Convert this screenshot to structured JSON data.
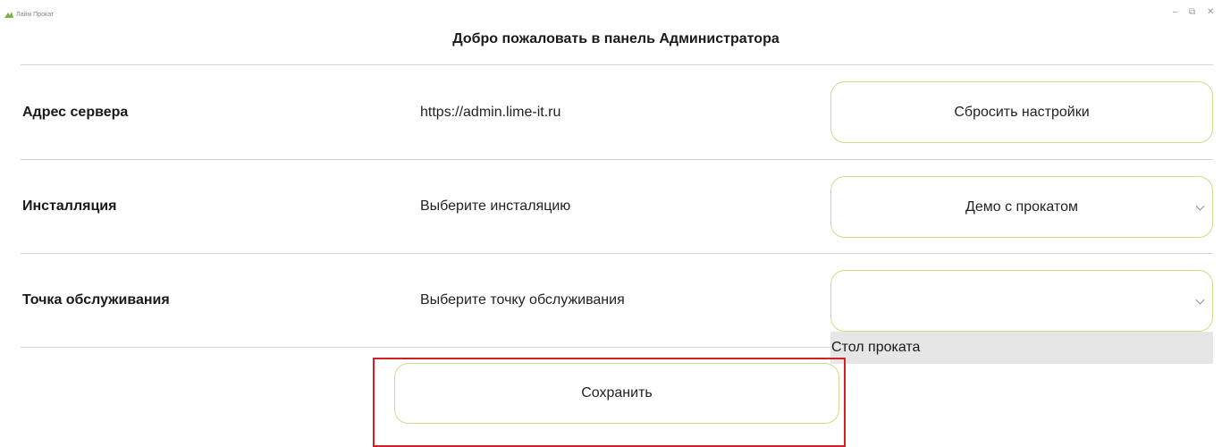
{
  "window": {
    "app_title": "Лайм Прокат",
    "minimize_glyph": "–",
    "restore_glyph": "⧉",
    "close_glyph": "✕"
  },
  "header": {
    "title": "Добро пожаловать в панель Администратора"
  },
  "rows": [
    {
      "label": "Адрес сервера",
      "value": "https://admin.lime-it.ru",
      "control": {
        "type": "button",
        "text": "Сбросить настройки"
      }
    },
    {
      "label": "Инсталляция",
      "value": "Выберите инсталяцию",
      "control": {
        "type": "select",
        "text": "Демо с прокатом"
      }
    },
    {
      "label": "Точка обслуживания",
      "value": "Выберите точку обслуживания",
      "control": {
        "type": "select",
        "text": ""
      }
    }
  ],
  "dropdown": {
    "options": [
      "Стол проката"
    ]
  },
  "save_button": {
    "label": "Сохранить"
  },
  "colors": {
    "accent_border": "#c9dd8f",
    "highlight": "#d42020",
    "divider": "#d4d4d4",
    "option_bg": "#e6e6e6"
  }
}
